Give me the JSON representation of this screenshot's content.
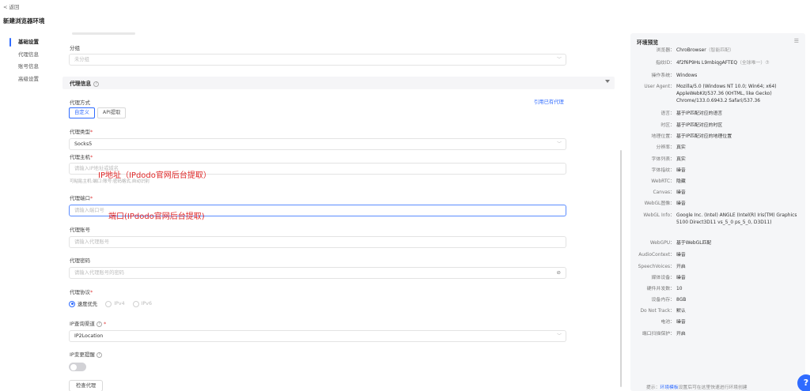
{
  "header": {
    "back_label": "< 返回",
    "title": "新建浏览器环境"
  },
  "nav": {
    "items": [
      "基础设置",
      "代理信息",
      "账号信息",
      "高级设置"
    ]
  },
  "group": {
    "label": "分组",
    "placeholder": "未分组"
  },
  "proxy_section": {
    "title": "代理信息"
  },
  "proxy_mode": {
    "label": "代理方式",
    "options": [
      "自定义",
      "API提取"
    ],
    "selected": "自定义",
    "reference_link": "引用已有代理"
  },
  "proxy_type": {
    "label": "代理类型",
    "value": "Socks5"
  },
  "proxy_host": {
    "label": "代理主机",
    "placeholder": "请输入IP地址或域名",
    "hint": "可粘贴主机:端口:账号:密码格式,自动识别"
  },
  "proxy_port": {
    "label": "代理端口",
    "placeholder": "请输入端口号"
  },
  "proxy_account": {
    "label": "代理账号",
    "placeholder": "请输入代理账号"
  },
  "proxy_password": {
    "label": "代理密码",
    "placeholder": "请输入代理账号的密码"
  },
  "proxy_protocol": {
    "label": "代理协议",
    "options": [
      "速度优先",
      "IPv4",
      "IPv6"
    ],
    "selected": "速度优先"
  },
  "ip_channel": {
    "label": "IP查询渠道",
    "value": "IP2Location"
  },
  "ip_change_alert": {
    "label": "IP变更提醒",
    "enabled": false
  },
  "check_button": {
    "label": "检查代理"
  },
  "annotations": {
    "host_note": "IP地址（IPdodo官网后台提取）",
    "port_note": "端口(IPdodo官网后台提取)"
  },
  "preview": {
    "title": "环境预览",
    "rows": [
      {
        "key": "浏览器",
        "value": "ChroBrowser",
        "sub": "（智能匹配）"
      },
      {
        "key": "指纹ID",
        "value": "4f2f6P9Hs L9mbiqgAFTEQ",
        "sub": "（全球唯一）⑦"
      },
      {
        "key": "操作系统",
        "value": "Windows"
      },
      {
        "key": "User Agent",
        "value": "Mozilla/5.0 (Windows NT 10.0; Win64; x64) AppleWebKit/537.36 (KHTML, like Gecko) Chrome/133.0.6943.2 Safari/537.36"
      },
      {
        "key": "语言",
        "value": "基于IP匹配对应的语言"
      },
      {
        "key": "时区",
        "value": "基于IP匹配对应的时区"
      },
      {
        "key": "地理位置",
        "value": "基于IP匹配对应的地理位置"
      },
      {
        "key": "分辨率",
        "value": "真实"
      },
      {
        "key": "字体列表",
        "value": "真实"
      },
      {
        "key": "字体指纹",
        "value": "噪音"
      },
      {
        "key": "WebRTC",
        "value": "隐藏"
      },
      {
        "key": "Canvas",
        "value": "噪音"
      },
      {
        "key": "WebGL图像",
        "value": "噪音"
      },
      {
        "key": "WebGL Info",
        "value": "Google Inc. (Intel) ANGLE (Intel(R) Iris(TM) Graphics 5100 Direct3D11 vs_5_0 ps_5_0, D3D11)"
      },
      {
        "key": "WebGPU",
        "value": "基于WebGL匹配"
      },
      {
        "key": "AudioContext",
        "value": "噪音"
      },
      {
        "key": "SpeechVoices",
        "value": "开启"
      },
      {
        "key": "媒体设备",
        "value": "噪音"
      },
      {
        "key": "硬件并发数",
        "value": "10"
      },
      {
        "key": "设备内存",
        "value": "8GB"
      },
      {
        "key": "Do Not Track",
        "value": "默认"
      },
      {
        "key": "电池",
        "value": "噪音"
      },
      {
        "key": "端口扫描保护",
        "value": "开启"
      }
    ],
    "footer_prefix": "提示：",
    "footer_link": "环境模板",
    "footer_suffix": "设置后可在这里快速进行环境创建"
  },
  "help": {
    "label": "?"
  }
}
